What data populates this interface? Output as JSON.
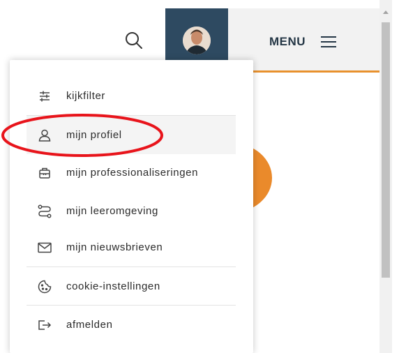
{
  "header": {
    "menu_label": "MENU",
    "accent_color": "#e8912d",
    "avatar_bg_color": "#2e4a61"
  },
  "icons": {
    "search": "search-icon",
    "avatar": "user-avatar-photo",
    "menu": "hamburger-menu-icon"
  },
  "dropdown": {
    "items": [
      {
        "label": "kijkfilter",
        "icon": "sliders-icon"
      },
      {
        "label": "mijn profiel",
        "icon": "user-icon",
        "highlighted": true
      },
      {
        "label": "mijn professionaliseringen",
        "icon": "briefcase-icon"
      },
      {
        "label": "mijn leeromgeving",
        "icon": "route-icon"
      },
      {
        "label": "mijn nieuwsbrieven",
        "icon": "envelope-icon"
      },
      {
        "label": "cookie-instellingen",
        "icon": "cookie-icon"
      },
      {
        "label": "afmelden",
        "icon": "logout-icon"
      }
    ]
  },
  "annotation_color": "#e8141b"
}
